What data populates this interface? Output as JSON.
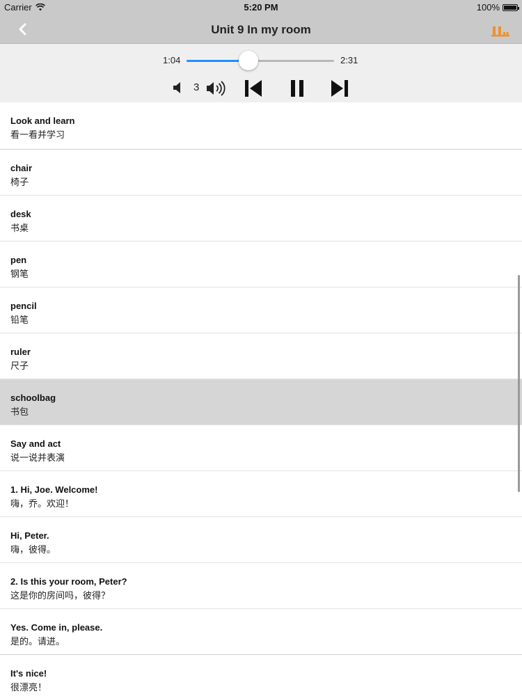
{
  "status_bar": {
    "carrier": "Carrier",
    "time": "5:20 PM",
    "battery": "100%",
    "battery_level": 1.0
  },
  "nav": {
    "title": "Unit 9  In my room",
    "back_icon": "chevron-left-icon",
    "menu_icon": "bars-icon",
    "accent_color": "#f0902a"
  },
  "player": {
    "current_time": "1:04",
    "total_time": "2:31",
    "progress": 0.42,
    "volume_level": "3",
    "accent_color": "#1e90ff"
  },
  "items": [
    {
      "en": "Look and learn",
      "zh": "看一看并学习"
    },
    {
      "en": "chair",
      "zh": "椅子"
    },
    {
      "en": "desk",
      "zh": "书桌"
    },
    {
      "en": "pen",
      "zh": "钢笔"
    },
    {
      "en": "pencil",
      "zh": "铅笔"
    },
    {
      "en": "ruler",
      "zh": "尺子"
    },
    {
      "en": "schoolbag",
      "zh": "书包",
      "selected": true
    },
    {
      "en": "Say and act",
      "zh": "说一说并表演"
    },
    {
      "en": "1. Hi, Joe. Welcome!",
      "zh": "嗨，乔。欢迎！"
    },
    {
      "en": "Hi, Peter.",
      "zh": "嗨，彼得。"
    },
    {
      "en": "2. Is this your room, Peter?",
      "zh": "这是你的房间吗，彼得？"
    },
    {
      "en": "Yes. Come in, please.",
      "zh": "是的。请进。"
    },
    {
      "en": "It's nice!",
      "zh": "很漂亮！"
    }
  ]
}
